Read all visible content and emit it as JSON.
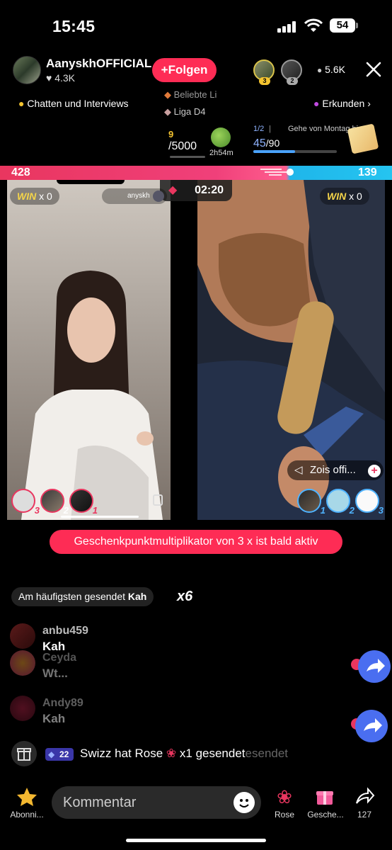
{
  "status": {
    "time": "15:45",
    "battery": "54"
  },
  "host": {
    "name": "AanyskhOFFICIAL",
    "likes": "4.3K",
    "follow_label": "Folgen"
  },
  "top_viewers": [
    {
      "rank": "3"
    },
    {
      "rank": "2"
    }
  ],
  "viewer_count": "5.6K",
  "topic": {
    "label": "Chatten und Interviews",
    "explore": "Erkunden"
  },
  "ticker": [
    "Beliebte Li",
    "Liga D4"
  ],
  "goal": {
    "current": "9",
    "target": "/5000",
    "timer": "2h54m"
  },
  "task": {
    "fraction": "1/2",
    "text": "Gehe von Montag bis Fr",
    "value": "45",
    "total": "/90",
    "progress": 0.5
  },
  "battle": {
    "score_left": "428",
    "score_right": "139",
    "timer": "02:20",
    "left_win": "WIN",
    "left_win_count": "x 0",
    "right_win": "WIN",
    "right_win_count": "x 0",
    "opponent_label": "anyskh",
    "right_mute_label": "Zois offi...",
    "left_contributors": [
      "3",
      "2",
      "1"
    ],
    "right_contributors": [
      "1",
      "2",
      "3"
    ]
  },
  "multiplier_banner": "Geschenkpunktmultiplikator von 3 x ist bald aktiv",
  "top_sender": {
    "prefix": "Am häufigsten gesendet",
    "name": "Kah",
    "times": "x6"
  },
  "chat": [
    {
      "name": "anbu459",
      "msg": "Kah"
    },
    {
      "name": "Ceyda",
      "msg": "Wt..."
    },
    {
      "name": "Andy89",
      "msg": "Kah"
    }
  ],
  "gift_event": {
    "level": "22",
    "text": "Swizz hat Rose",
    "suffix": "x1 gesendet",
    "ghost": "esendet"
  },
  "bottom_bar": {
    "subscribe": "Abonni...",
    "comment_placeholder": "Kommentar",
    "rose": "Rose",
    "gifts": "Gesche...",
    "share_count": "127"
  },
  "colors": {
    "accent": "#fe2c55",
    "blue": "#25c4f0",
    "gold": "#f4d44a"
  }
}
